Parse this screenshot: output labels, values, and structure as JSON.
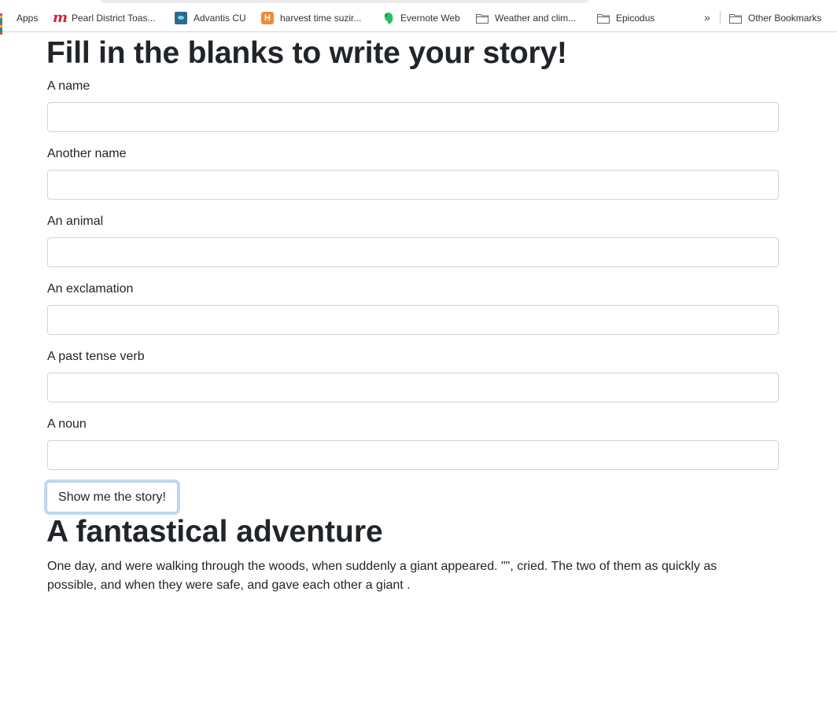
{
  "bookmarks": [
    {
      "label": "Apps",
      "icon": "apps-grid-icon"
    },
    {
      "label": "Pearl District Toas...",
      "icon": "m-logo-icon"
    },
    {
      "label": "Advantis CU",
      "icon": "advantis-logo-icon"
    },
    {
      "label": "harvest time suzir...",
      "icon": "harvest-logo-icon"
    },
    {
      "label": "Evernote Web",
      "icon": "evernote-logo-icon"
    },
    {
      "label": "Weather and clim...",
      "icon": "folder-icon"
    },
    {
      "label": "Epicodus",
      "icon": "folder-icon"
    }
  ],
  "bookmarks_overflow": "»",
  "other_bookmarks": {
    "label": "Other Bookmarks",
    "icon": "folder-icon"
  },
  "page": {
    "title": "Fill in the blanks to write your story!",
    "fields": [
      {
        "label": "A name",
        "value": ""
      },
      {
        "label": "Another name",
        "value": ""
      },
      {
        "label": "An animal",
        "value": ""
      },
      {
        "label": "An exclamation",
        "value": ""
      },
      {
        "label": "A past tense verb",
        "value": ""
      },
      {
        "label": "A noun",
        "value": ""
      }
    ],
    "submit_label": "Show me the story!",
    "story_title": "A fantastical adventure",
    "story_text": "One day, and were walking through the woods, when suddenly a giant appeared. \"\", cried. The two of them as quickly as possible, and when they were safe, and gave each other a giant ."
  },
  "colors": {
    "text": "#212529",
    "input_border": "#ced4da",
    "focus_ring": "#90baec"
  }
}
